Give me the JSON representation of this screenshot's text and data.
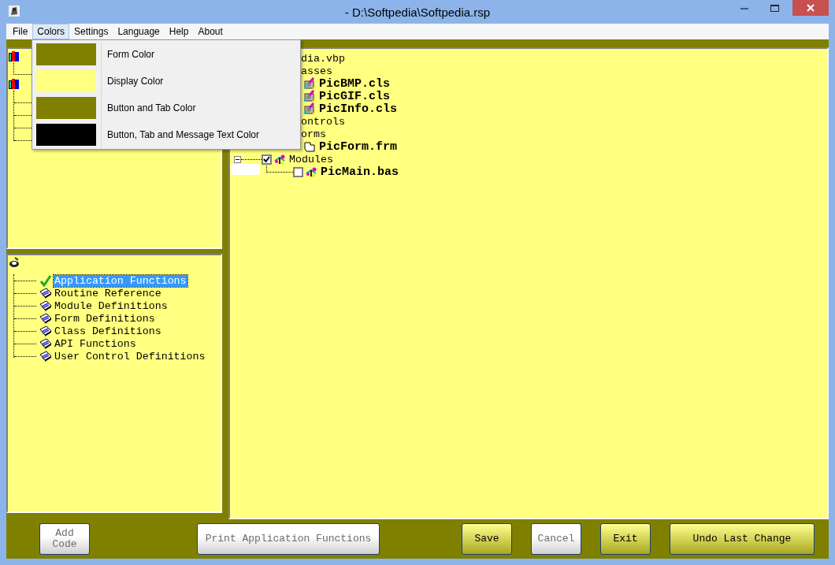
{
  "window": {
    "title": "- D:\\Softpedia\\Softpedia.rsp"
  },
  "menu": [
    {
      "label": "File",
      "selected": false
    },
    {
      "label": "Colors",
      "selected": true
    },
    {
      "label": "Settings",
      "selected": false
    },
    {
      "label": "Language",
      "selected": false
    },
    {
      "label": "Help",
      "selected": false
    },
    {
      "label": "About",
      "selected": false
    }
  ],
  "colors_menu": [
    {
      "label": "Form Color",
      "color": "#808000"
    },
    {
      "label": "Display Color",
      "color": "#ffff80"
    },
    {
      "label": "Button and Tab Color",
      "color": "#808000"
    },
    {
      "label": "Button, Tab and Message Text Color",
      "color": "#000000"
    }
  ],
  "project_tree": [
    {
      "label": "dia.vbp",
      "cut": true,
      "children": [
        {
          "label": "asses",
          "cut": true,
          "children": [
            {
              "label": "PicBMP.cls",
              "kind": "class"
            },
            {
              "label": "PicGIF.cls",
              "kind": "class"
            },
            {
              "label": "PicInfo.cls",
              "kind": "class"
            }
          ]
        },
        {
          "label": "ontrols",
          "cut": true
        },
        {
          "label": "orms",
          "cut": true,
          "children": [
            {
              "label": "PicForm.frm",
              "kind": "form"
            }
          ]
        },
        {
          "label": "Modules",
          "kind": "group",
          "expanded": true,
          "checked": true,
          "children": [
            {
              "label": "PicMain.bas",
              "kind": "module",
              "checked": false
            }
          ]
        }
      ]
    }
  ],
  "functions_tree": [
    {
      "label": "Application Functions",
      "selected": true
    },
    {
      "label": "Routine Reference",
      "selected": false
    },
    {
      "label": "Module Definitions",
      "selected": false
    },
    {
      "label": "Form Definitions",
      "selected": false
    },
    {
      "label": "Class Definitions",
      "selected": false
    },
    {
      "label": "API Functions",
      "selected": false
    },
    {
      "label": "User Control Definitions",
      "selected": false
    }
  ],
  "buttons": [
    {
      "label": "Add Code",
      "disabled": true
    },
    {
      "label": "Print Application Functions",
      "disabled": true
    },
    {
      "label": "Save",
      "disabled": false
    },
    {
      "label": "Cancel",
      "disabled": true
    },
    {
      "label": "Exit",
      "disabled": false
    },
    {
      "label": "Undo Last Change",
      "disabled": false
    }
  ]
}
